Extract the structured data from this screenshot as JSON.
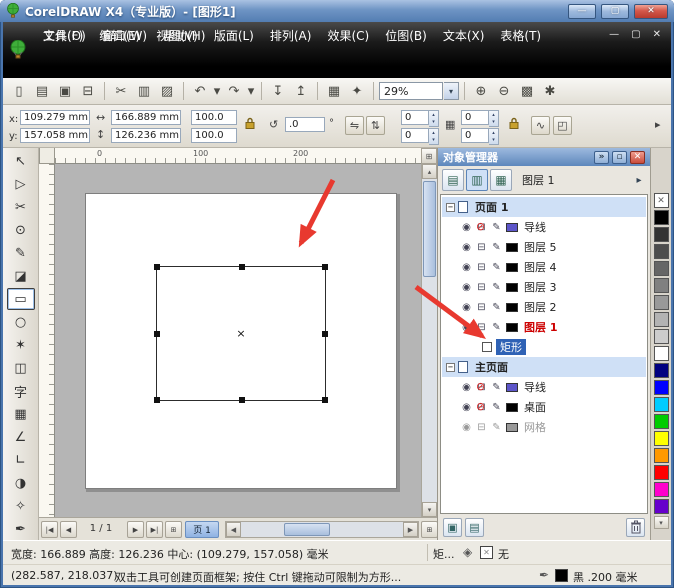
{
  "window": {
    "title": "CorelDRAW X4（专业版）- [图形1]",
    "minimize": "—",
    "maximize": "▢",
    "close": "✕"
  },
  "menu": {
    "row1": [
      "文件(F)",
      "编辑(E)",
      "视图(V)",
      "版面(L)",
      "排列(A)",
      "效果(C)",
      "位图(B)",
      "文本(X)",
      "表格(T)"
    ],
    "row2": [
      "工具(O)",
      "窗口(W)",
      "帮助(H)"
    ],
    "doc_minimize": "—",
    "doc_restore": "▢",
    "doc_close": "✕"
  },
  "toolbar": {
    "icons": [
      {
        "name": "new-document",
        "glyph": "▯"
      },
      {
        "name": "open",
        "glyph": "▤"
      },
      {
        "name": "save",
        "glyph": "▣"
      },
      {
        "name": "print",
        "glyph": "⊟"
      },
      {
        "name": "cut",
        "glyph": "✂"
      },
      {
        "name": "copy",
        "glyph": "▥"
      },
      {
        "name": "paste",
        "glyph": "▨"
      },
      {
        "name": "undo",
        "glyph": "↶"
      },
      {
        "name": "undo-list",
        "glyph": "▾"
      },
      {
        "name": "redo",
        "glyph": "↷"
      },
      {
        "name": "redo-list",
        "glyph": "▾"
      },
      {
        "name": "import",
        "glyph": "↧"
      },
      {
        "name": "export",
        "glyph": "↥"
      },
      {
        "name": "application-launcher",
        "glyph": "▦"
      },
      {
        "name": "welcome-screen",
        "glyph": "✦"
      }
    ],
    "zoom_value": "29%",
    "dropdown": "▾",
    "right_icons": [
      {
        "name": "zoom-in",
        "glyph": "⊕"
      },
      {
        "name": "zoom-out",
        "glyph": "⊖"
      },
      {
        "name": "snap-to",
        "glyph": "▩"
      },
      {
        "name": "options",
        "glyph": "✱"
      }
    ]
  },
  "propbar": {
    "x_label": "x:",
    "x_value": "109.279 mm",
    "y_label": "y:",
    "y_value": "157.058 mm",
    "size_icon_h": "↔",
    "size_icon_v": "↕",
    "width_value": "166.889 mm",
    "height_value": "126.236 mm",
    "scale_h": "100.0",
    "scale_v": "100.0",
    "rotation_icon": "↺",
    "rotation_value": ".0",
    "rotation_unit": "°",
    "mirror_h": "⇋",
    "mirror_v": "⇅",
    "corner_tl": "0",
    "corner_tr": "0",
    "corner_bl": "0",
    "corner_br": "0",
    "checker": "▦",
    "extra1": "∿",
    "extra2": "◰",
    "overflow": "▸",
    "spin_up": "▴",
    "spin_down": "▾"
  },
  "ruler": {
    "labels": [
      "0",
      "100",
      "200"
    ]
  },
  "toolbox": {
    "tools": [
      {
        "name": "pick",
        "glyph": "↖"
      },
      {
        "name": "shape",
        "glyph": "▷"
      },
      {
        "name": "crop",
        "glyph": "✂"
      },
      {
        "name": "zoom",
        "glyph": "⊙"
      },
      {
        "name": "freehand",
        "glyph": "✎"
      },
      {
        "name": "smart-fill",
        "glyph": "◪"
      },
      {
        "name": "rectangle",
        "glyph": "▭"
      },
      {
        "name": "ellipse",
        "glyph": "○"
      },
      {
        "name": "polygon",
        "glyph": "✶"
      },
      {
        "name": "basic-shapes",
        "glyph": "◫"
      },
      {
        "name": "text",
        "glyph": "字"
      },
      {
        "name": "table",
        "glyph": "▦"
      },
      {
        "name": "dimension",
        "glyph": "∠"
      },
      {
        "name": "connector",
        "glyph": "∟"
      },
      {
        "name": "blend",
        "glyph": "◑"
      },
      {
        "name": "eyedropper",
        "glyph": "✧"
      },
      {
        "name": "outline-pen",
        "glyph": "✒"
      }
    ]
  },
  "canvas": {
    "center_mark": "×"
  },
  "vscroll": {
    "up": "▴",
    "down": "▾",
    "corner": "⊞"
  },
  "nav": {
    "first": "|◀",
    "prev": "◀",
    "indicator": "1 / 1",
    "next": "▶",
    "last": "▶|",
    "add_page": "⊞",
    "page_tab": "页 1",
    "h_left": "◀",
    "h_right": "▶",
    "corner": "⊞"
  },
  "docker": {
    "title": "对象管理器",
    "collapse": "»",
    "shade": "▫",
    "close": "✕",
    "view_icons": [
      "▤",
      "▥",
      "▦"
    ],
    "active_layer": "图层 1",
    "flyout": "▸",
    "icons": {
      "eye": "◉",
      "printer": "⊟",
      "pencil": "✎",
      "blocked": "⊘",
      "minus": "−"
    },
    "rows": [
      {
        "kind": "page",
        "label": "页面 1"
      },
      {
        "kind": "layer",
        "name": "导线",
        "chip": "#5c55c8",
        "crossed": true
      },
      {
        "kind": "layer",
        "name": "图层 5",
        "chip": "#000000"
      },
      {
        "kind": "layer",
        "name": "图层 4",
        "chip": "#000000"
      },
      {
        "kind": "layer",
        "name": "图层 3",
        "chip": "#000000"
      },
      {
        "kind": "layer",
        "name": "图层 2",
        "chip": "#000000"
      },
      {
        "kind": "layer",
        "name": "图层 1",
        "chip": "#000000",
        "active": true
      },
      {
        "kind": "object",
        "name": "矩形",
        "selected": true
      },
      {
        "kind": "page",
        "label": "主页面"
      },
      {
        "kind": "layer",
        "name": "导线",
        "chip": "#5c55c8",
        "crossed": true
      },
      {
        "kind": "layer",
        "name": "桌面",
        "chip": "#000000",
        "crossed": true
      },
      {
        "kind": "layer",
        "name": "网格",
        "chip": "#999999",
        "grayed": true
      }
    ],
    "new_layer": "▣",
    "new_master_layer": "▤"
  },
  "palette": {
    "none": "✕",
    "colors": [
      "#000000",
      "#333333",
      "#4d4d4d",
      "#666666",
      "#808080",
      "#999999",
      "#b3b3b3",
      "#cccccc",
      "#ffffff",
      "#000080",
      "#0000ff",
      "#00ccff",
      "#00cc00",
      "#ffff00",
      "#ff9900",
      "#ff0000",
      "#ff00cc",
      "#6600cc"
    ],
    "more": "▾"
  },
  "status": {
    "size_info": "宽度: 166.889 高度: 126.236 中心: (109.279, 157.058) 毫米",
    "object_info": "矩...",
    "fill_icon": "◈",
    "fill_none": "✕",
    "fill_label": "无",
    "coords": "(282.587, 218.037)",
    "hint": "双击工具可创建页面框架; 按住 Ctrl 键拖动可限制为方形...",
    "outline_icon": "✒",
    "outline_label": "黑 .200 毫米"
  },
  "colors": {
    "accent": "#316ac5",
    "arrow": "#e8392f",
    "layer_active_text": "#cc0000"
  }
}
